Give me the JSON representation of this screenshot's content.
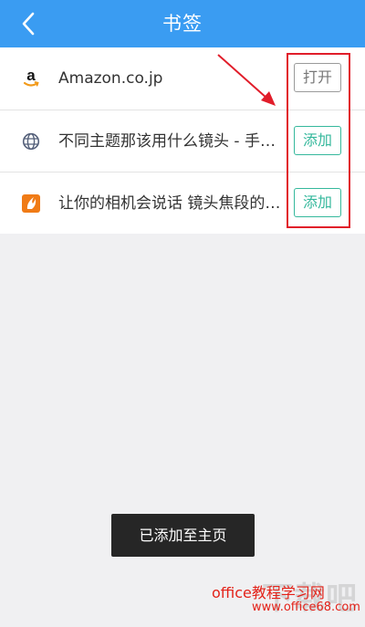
{
  "header": {
    "title": "书签",
    "back_icon": "chevron-left-icon"
  },
  "bookmarks": [
    {
      "title": "Amazon.co.jp",
      "icon": "amazon-logo-icon",
      "action": "打开",
      "state": "open"
    },
    {
      "title": "不同主题那该用什么镜头 - 手…",
      "icon": "globe-icon",
      "action": "添加",
      "state": "add"
    },
    {
      "title": "让你的相机会说话 镜头焦段的…",
      "icon": "orange-flame-icon",
      "action": "添加",
      "state": "add"
    }
  ],
  "toast": "已添加至主页",
  "annotation": {
    "color": "#e11d2a"
  },
  "watermark": {
    "line1": "office教程学习网",
    "line2": "www.office68.com",
    "big": "下载吧"
  },
  "colors": {
    "header": "#3a9cf2",
    "add_button": "#35b89c",
    "open_button": "#777777"
  }
}
